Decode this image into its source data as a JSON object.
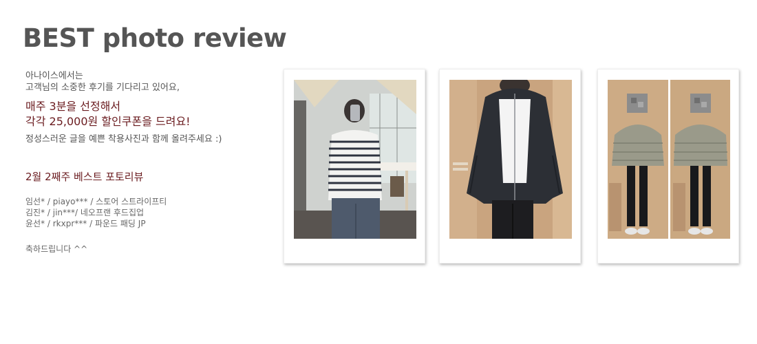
{
  "heading": "BEST photo review",
  "intro": [
    "아나이스에서는",
    "고객님의 소중한 후기를 기다리고 있어요,"
  ],
  "highlight": [
    "매주 3분을 선정해서",
    "각각 25,000원 할인쿠폰을 드려요!"
  ],
  "description": "정성스러운 글을 예쁜 착용사진과 함께 올려주세요 :)",
  "week_title": "2월 2째주 베스트 포토리뷰",
  "winners": [
    "임선* / piayo*** / 스토어 스트라이프티",
    "김진* / jin***/ 네오프랜 후드집업",
    "윤선* / rkxpr***  / 파운드 패딩 JP"
  ],
  "congrats": "축하드립니다 ^^",
  "colors": {
    "heading": "#555555",
    "accent": "#6a1b1f",
    "body_text": "#555555"
  },
  "photos": [
    {
      "subject": "woman in striped long-sleeve tee taking mirror selfie"
    },
    {
      "subject": "person in black neoprene hooded zip-up jacket"
    },
    {
      "subject": "two mirror selfies of person in khaki puffer padding jacket"
    }
  ]
}
